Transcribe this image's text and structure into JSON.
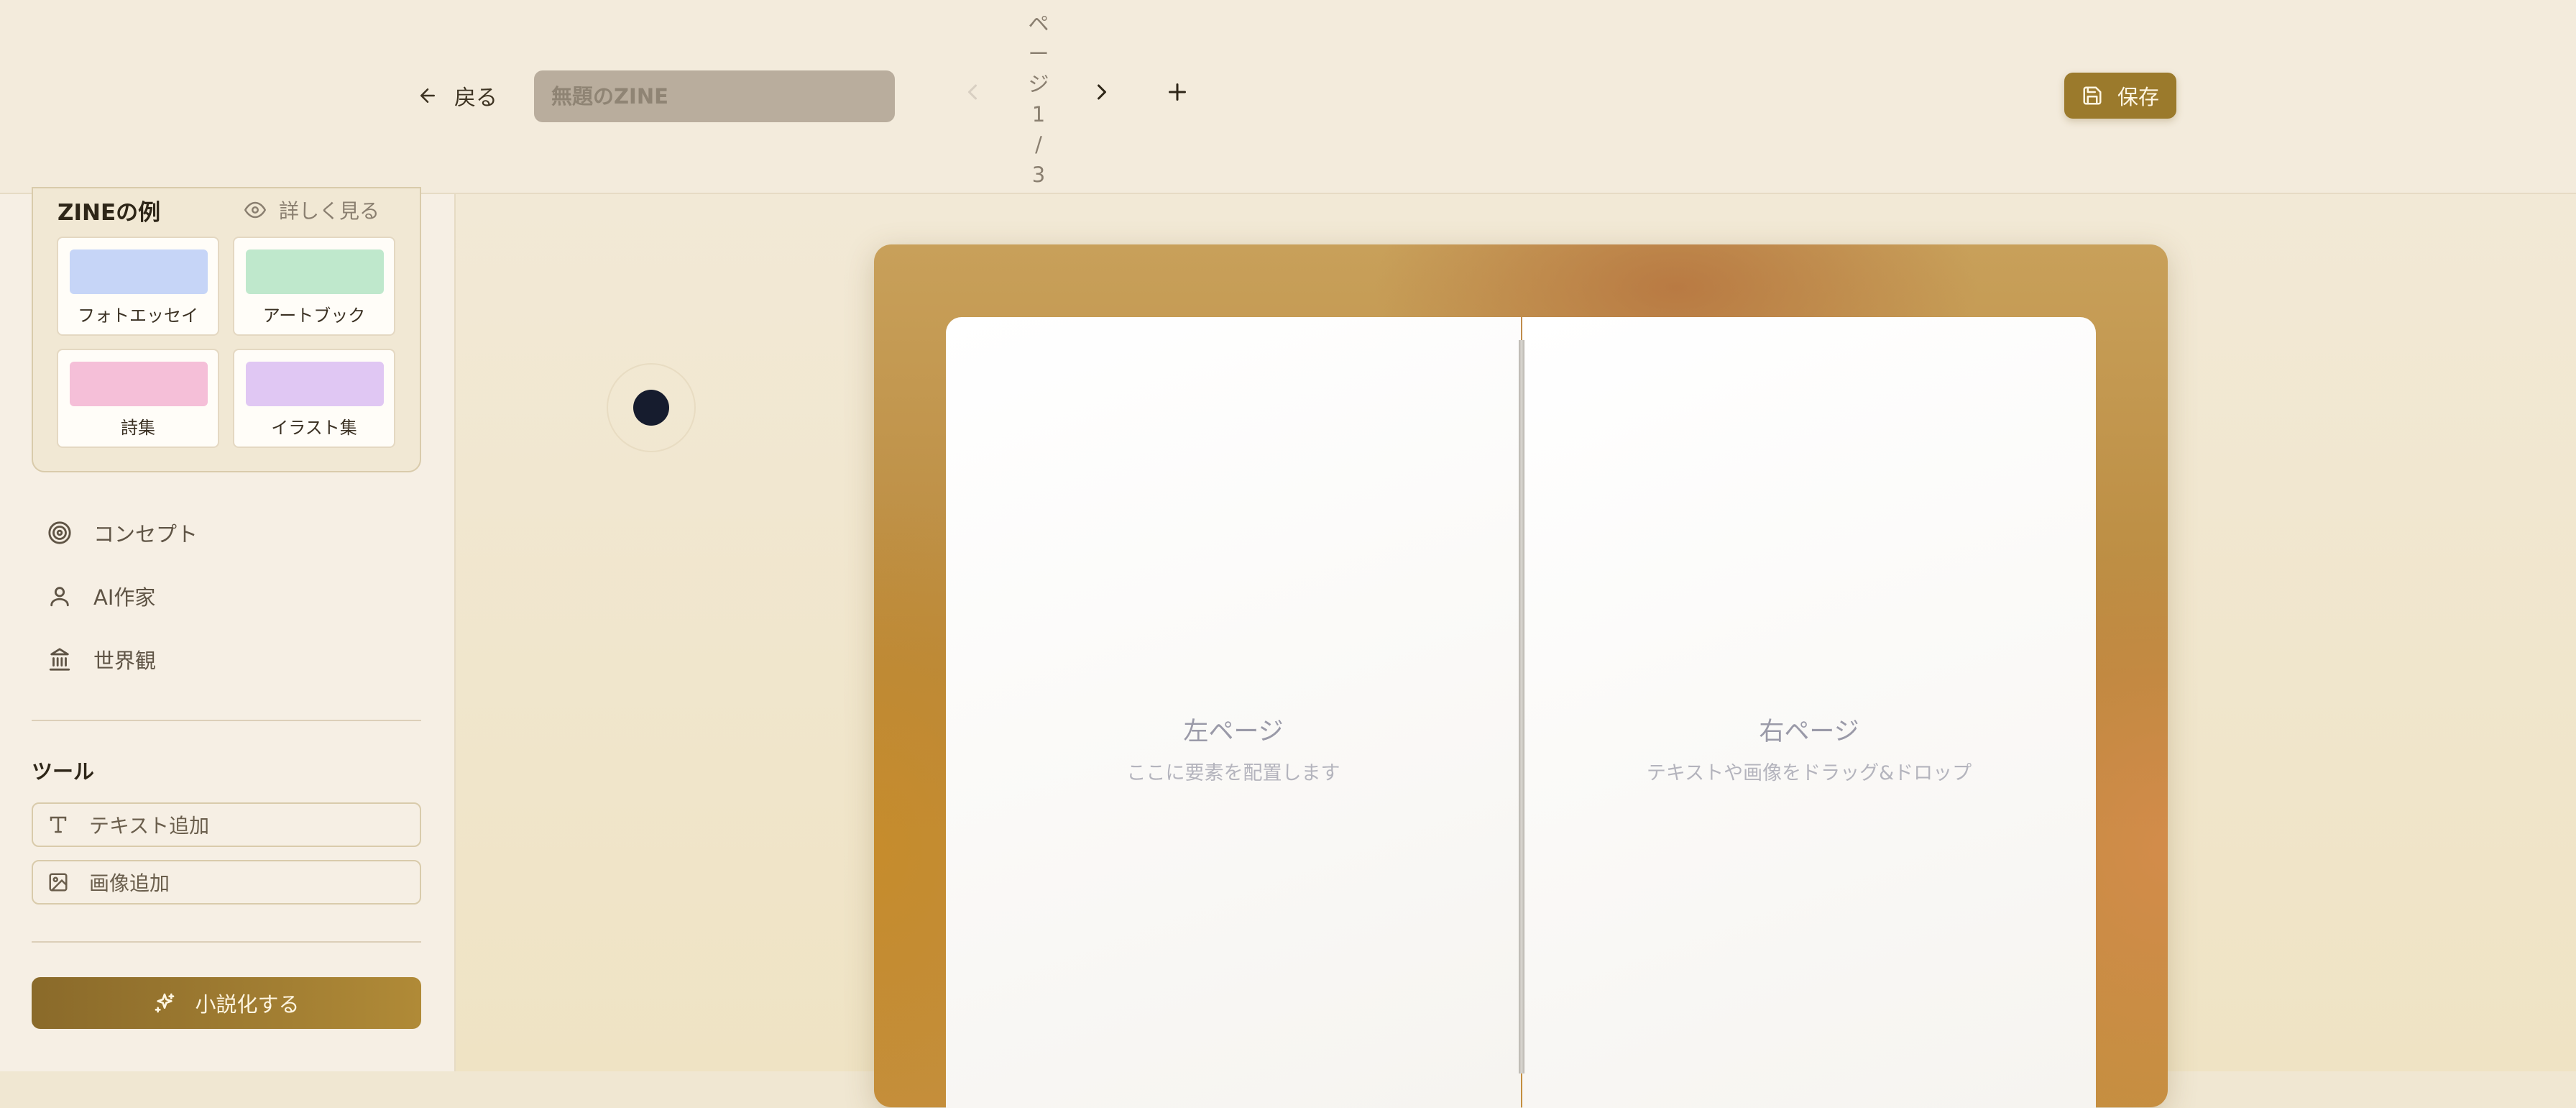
{
  "header": {
    "back_label": "戻る",
    "title_placeholder": "無題のZINE",
    "page_indicator": [
      "ペ",
      "ー",
      "ジ",
      "1",
      "/",
      "3"
    ],
    "save_label": "保存"
  },
  "sidebar": {
    "examples": {
      "title": "ZINEの例",
      "more_label": "詳しく見る",
      "items": [
        {
          "label": "フォトエッセイ",
          "color": "#c6d5f7"
        },
        {
          "label": "アートブック",
          "color": "#bfe8cc"
        },
        {
          "label": "詩集",
          "color": "#f5bfd8"
        },
        {
          "label": "イラスト集",
          "color": "#e0c7f3"
        }
      ]
    },
    "nav": [
      {
        "label": "コンセプト",
        "icon": "target-icon"
      },
      {
        "label": "AI作家",
        "icon": "user-icon"
      },
      {
        "label": "世界観",
        "icon": "landmark-icon"
      }
    ],
    "tools_title": "ツール",
    "tools": [
      {
        "label": "テキスト追加",
        "icon": "text-icon"
      },
      {
        "label": "画像追加",
        "icon": "image-icon"
      }
    ],
    "novelize_label": "小説化する"
  },
  "canvas": {
    "left_page": {
      "title": "左ページ",
      "subtitle": "ここに要素を配置します"
    },
    "right_page": {
      "title": "右ページ",
      "subtitle": "テキストや画像をドラッグ&ドロップ"
    }
  },
  "colors": {
    "accent": "#9b7a2c",
    "header_bg": "#f3ebdc",
    "sidebar_bg": "#f6efe4"
  }
}
